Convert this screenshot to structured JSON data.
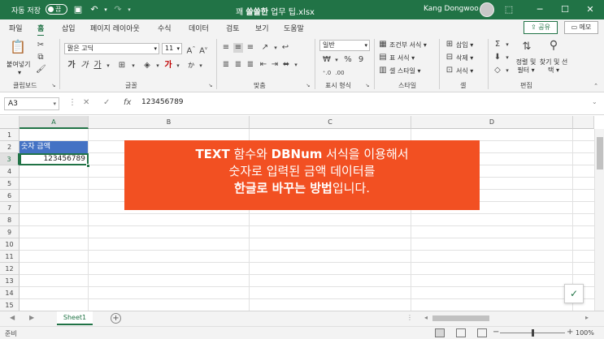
{
  "titlebar": {
    "autosave_label": "자동 저장",
    "autosave_state": "끔",
    "doc_title_prefix": "꽤 ",
    "doc_title_bold": "쓸쓸한",
    "doc_title_suffix": " 업무 팁.xlsx",
    "user_name": "Kang Dongwoo"
  },
  "tabs": [
    "파일",
    "홈",
    "삽입",
    "페이지 레이아웃",
    "수식",
    "데이터",
    "검토",
    "보기",
    "도움말"
  ],
  "active_tab": "홈",
  "share_label": "공유",
  "memo_label": "메모",
  "ribbon": {
    "paste_label": "붙여넣기",
    "font_name": "맑은 고딕",
    "font_size": "11",
    "number_format": "일반",
    "conditional_format": "조건부 서식",
    "table_format": "표 서식",
    "cell_style": "셀 스타일",
    "insert": "삽입",
    "delete": "삭제",
    "format": "서식",
    "sort_filter": "정렬 및 필터",
    "find_select": "찾기 및 선택",
    "groups": {
      "clipboard": "클립보드",
      "font": "글꼴",
      "alignment": "맞춤",
      "number": "표시 형식",
      "style": "스타일",
      "cells": "셀",
      "editing": "편집"
    }
  },
  "formula_bar": {
    "name_box": "A3",
    "formula": "123456789"
  },
  "columns": [
    "A",
    "B",
    "C",
    "D"
  ],
  "rows": [
    "1",
    "2",
    "3",
    "4",
    "5",
    "6",
    "7",
    "8",
    "9",
    "10",
    "11",
    "12",
    "13",
    "14",
    "15"
  ],
  "cells": {
    "A2": "숫자 금액",
    "A3": "123456789"
  },
  "banner": {
    "line1_b1": "TEXT",
    "line1_t1": " 함수와 ",
    "line1_b2": "DBNum",
    "line1_t2": " 서식을 이용해서",
    "line2": "숫자로 입력된 금액 데이터를",
    "line3_b": "한글로 바꾸는 방법",
    "line3_t": "입니다."
  },
  "sheet_tab": "Sheet1",
  "status": {
    "ready": "준비",
    "zoom": "100%"
  },
  "colors": {
    "excel_green": "#217346",
    "banner": "#f25022",
    "selected_cell_fill": "#4472c4"
  }
}
